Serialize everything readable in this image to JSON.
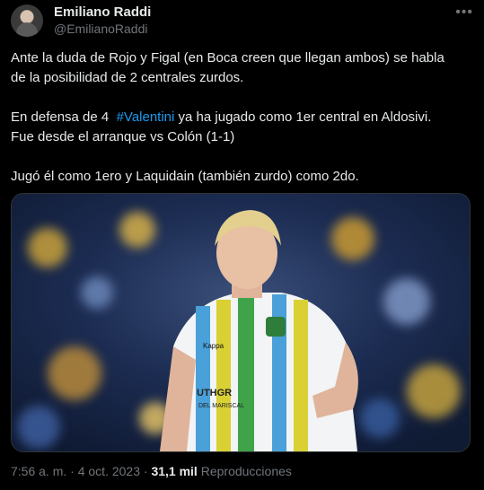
{
  "author": {
    "name": "Emiliano Raddi",
    "handle": "@EmilianoRaddi"
  },
  "more_icon": "more-horizontal-icon",
  "tweet": {
    "line1": "Ante la duda de Rojo y Figal (en Boca creen que llegan ambos) se habla",
    "line2": "de la posibilidad de 2 centrales zurdos.",
    "line3_before": "En defensa de 4  ",
    "hashtag": "#Valentini",
    "line3_after": " ya ha jugado como 1er central en Aldosivi.",
    "line4": "Fue desde el arranque vs Colón (1-1)",
    "line5": "Jugó él como 1ero y Laquidain (también zurdo) como 2do."
  },
  "photo": {
    "jersey_brand": "Kappa",
    "jersey_sponsor": "UTHGR",
    "jersey_sponsor2": "DEL MARISCAL"
  },
  "meta": {
    "time": "7:56 a. m.",
    "separator": "·",
    "date": "4 oct. 2023",
    "views_count": "31,1 mil",
    "views_label": "Reproducciones"
  },
  "colors": {
    "background": "#000000",
    "text": "#e7e9ea",
    "secondary": "#71767b",
    "link": "#1d9bf0"
  }
}
